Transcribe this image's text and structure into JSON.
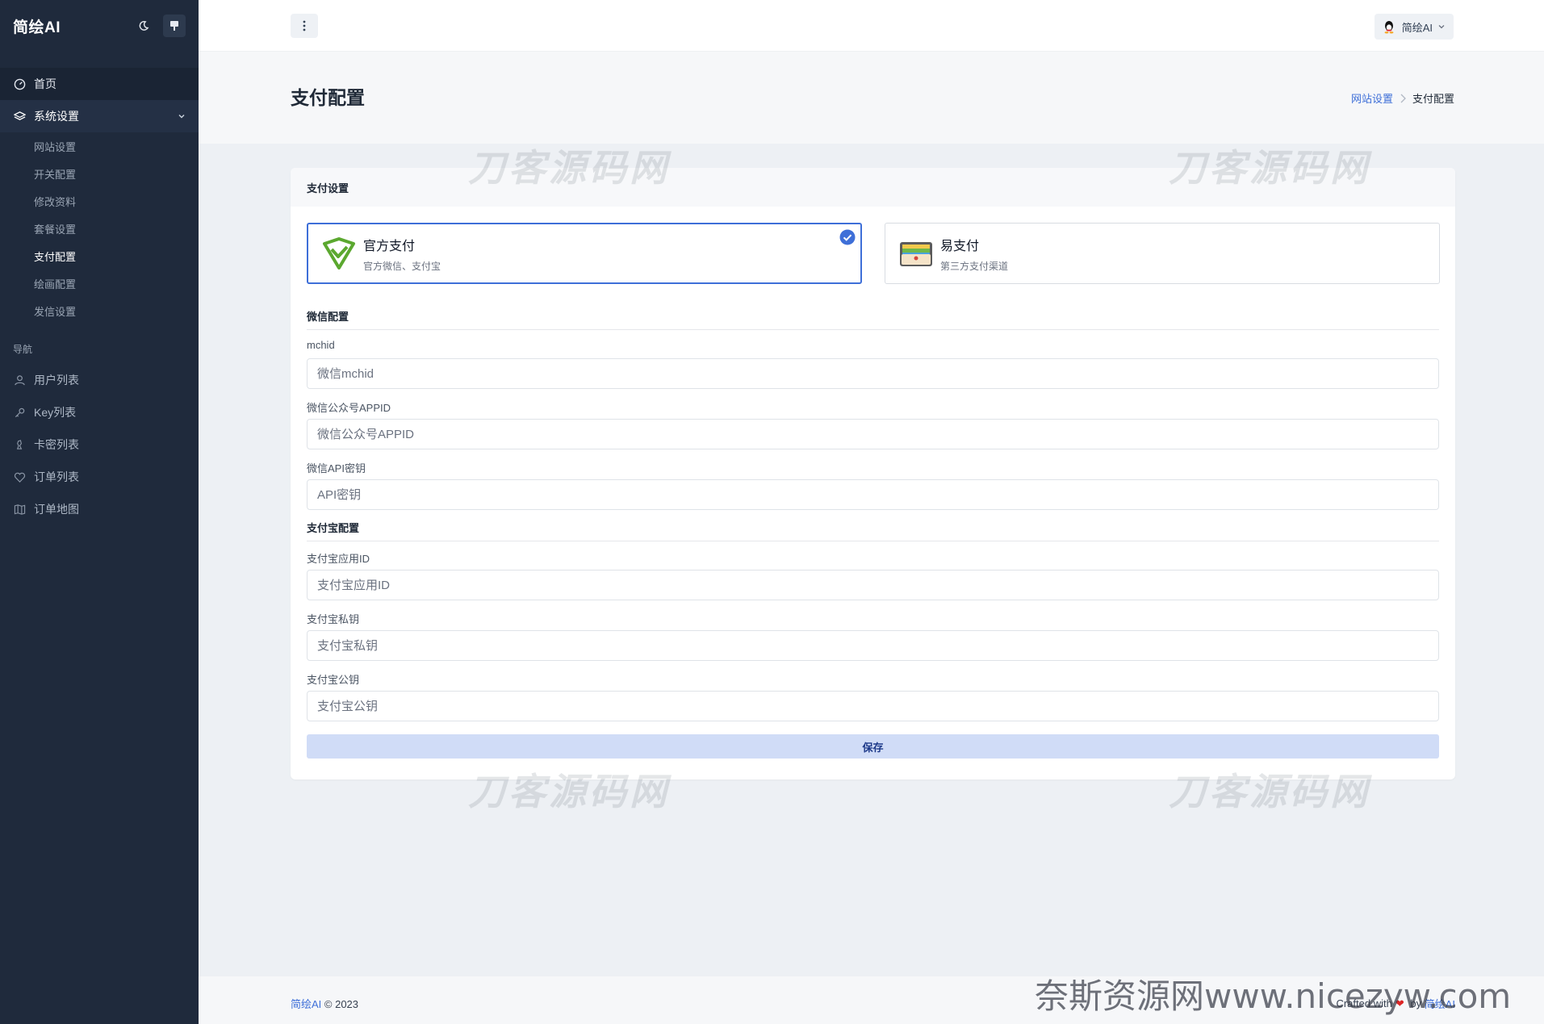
{
  "brand": "简绘AI",
  "sidebar": {
    "home": "首页",
    "system": "系统设置",
    "sub_items": [
      "网站设置",
      "开关配置",
      "修改资料",
      "套餐设置",
      "支付配置",
      "绘画配置",
      "发信设置"
    ],
    "active_sub": "支付配置",
    "nav_heading": "导航",
    "nav_items": [
      {
        "label": "用户列表",
        "icon": "user-icon"
      },
      {
        "label": "Key列表",
        "icon": "key-icon"
      },
      {
        "label": "卡密列表",
        "icon": "chess-icon"
      },
      {
        "label": "订单列表",
        "icon": "heart-icon"
      },
      {
        "label": "订单地图",
        "icon": "map-icon"
      }
    ]
  },
  "topbar": {
    "user_name": "简绘AI"
  },
  "page": {
    "title": "支付配置",
    "breadcrumb": {
      "parent": "网站设置",
      "current": "支付配置"
    }
  },
  "card": {
    "title": "支付设置",
    "options": [
      {
        "title": "官方支付",
        "desc": "官方微信、支付宝",
        "selected": true
      },
      {
        "title": "易支付",
        "desc": "第三方支付渠道",
        "selected": false
      }
    ],
    "wechat": {
      "section": "微信配置",
      "mchid_label": "mchid",
      "mchid_placeholder": "微信mchid",
      "appid_label": "微信公众号APPID",
      "appid_placeholder": "微信公众号APPID",
      "apikey_label": "微信API密钥",
      "apikey_placeholder": "API密钥"
    },
    "alipay": {
      "section": "支付宝配置",
      "appid_label": "支付宝应用ID",
      "appid_placeholder": "支付宝应用ID",
      "privkey_label": "支付宝私钥",
      "privkey_placeholder": "支付宝私钥",
      "pubkey_label": "支付宝公钥",
      "pubkey_placeholder": "支付宝公钥"
    },
    "save_label": "保存"
  },
  "watermark": "刀客源码网",
  "footer": {
    "brand": "简绘AI",
    "copyright": " © 2023",
    "crafted_prefix": "Crafted with",
    "heart": "❤",
    "crafted_by": " by ",
    "crafted_brand": "简绘AI"
  },
  "site_watermark": "奈斯资源网www.nicezyw.com",
  "colors": {
    "sidebar_bg": "#1f2a3c",
    "accent": "#3e6fd8",
    "save_bg": "#d0dcf7"
  }
}
